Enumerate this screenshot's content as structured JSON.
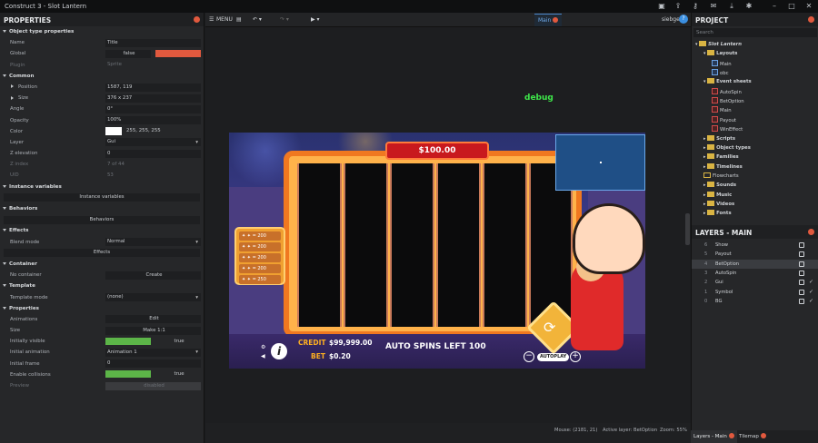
{
  "window": {
    "title": "Construct 3 - Slot Lantern"
  },
  "properties": {
    "title": "PROPERTIES",
    "rows": [
      {
        "type": "sec",
        "label": "Object type properties"
      },
      {
        "type": "row",
        "label": "Name",
        "value": "Title"
      },
      {
        "type": "global",
        "label": "Global",
        "value": "false"
      },
      {
        "type": "row",
        "label": "Plugin",
        "value": "Sprite",
        "dim": true
      },
      {
        "type": "sec",
        "label": "Common"
      },
      {
        "type": "exp",
        "label": "Position",
        "value": "1587, 119"
      },
      {
        "type": "exp",
        "label": "Size",
        "value": "376 x 237"
      },
      {
        "type": "row",
        "label": "Angle",
        "value": "0°"
      },
      {
        "type": "row",
        "label": "Opacity",
        "value": "100%"
      },
      {
        "type": "color",
        "label": "Color",
        "value": "255, 255, 255"
      },
      {
        "type": "select",
        "label": "Layer",
        "value": "Gui"
      },
      {
        "type": "row",
        "label": "Z elevation",
        "value": "0"
      },
      {
        "type": "row",
        "label": "Z index",
        "value": "7 of 44",
        "dim": true
      },
      {
        "type": "row",
        "label": "UID",
        "value": "53",
        "dim": true
      },
      {
        "type": "sec",
        "label": "Instance variables"
      },
      {
        "type": "wide",
        "value": "Instance variables"
      },
      {
        "type": "sec",
        "label": "Behaviors"
      },
      {
        "type": "wide",
        "value": "Behaviors"
      },
      {
        "type": "sec",
        "label": "Effects"
      },
      {
        "type": "select",
        "label": "Blend mode",
        "value": "Normal"
      },
      {
        "type": "wide",
        "value": "Effects"
      },
      {
        "type": "sec",
        "label": "Container"
      },
      {
        "type": "btn",
        "label": "No container",
        "value": "Create"
      },
      {
        "type": "sec",
        "label": "Template"
      },
      {
        "type": "select",
        "label": "Template mode",
        "value": "(none)"
      },
      {
        "type": "sec",
        "label": "Properties"
      },
      {
        "type": "btn",
        "label": "Animations",
        "value": "Edit"
      },
      {
        "type": "btn",
        "label": "Size",
        "value": "Make 1:1"
      },
      {
        "type": "bool",
        "label": "Initially visible",
        "value": "true"
      },
      {
        "type": "select",
        "label": "Initial animation",
        "value": "Animation 1"
      },
      {
        "type": "row",
        "label": "Initial frame",
        "value": "0"
      },
      {
        "type": "bool",
        "label": "Enable collisions",
        "value": "true"
      },
      {
        "type": "row",
        "label": "Preview",
        "value": "disabled",
        "dim": true
      }
    ]
  },
  "toolbar": {
    "menu": "MENU",
    "tab": "Main",
    "user": "siebgen"
  },
  "game": {
    "debug": "debug",
    "balance": "$100.00",
    "credit_label": "CREDIT",
    "credit": "$99,999.00",
    "bet_label": "BET",
    "bet": "$0.20",
    "auto_spins": "AUTO SPINS LEFT 100",
    "autoplay": "AUTOPLAY",
    "paytable": [
      "= 200",
      "= 200",
      "= 200",
      "= 200",
      "= 250"
    ]
  },
  "status": {
    "mouse": "Mouse: (2181, 21)",
    "layer": "Active layer: BetOption",
    "zoom": "Zoom: 55%"
  },
  "project": {
    "title": "PROJECT",
    "search": "Search",
    "tree": [
      {
        "d": 0,
        "k": "fo",
        "t": "Slot Lantern",
        "i": true
      },
      {
        "d": 1,
        "k": "fo",
        "t": "Layouts"
      },
      {
        "d": 2,
        "k": "ly",
        "t": "Main"
      },
      {
        "d": 2,
        "k": "ly",
        "t": "obc"
      },
      {
        "d": 1,
        "k": "fo",
        "t": "Event sheets"
      },
      {
        "d": 2,
        "k": "ev",
        "t": "AutoSpin"
      },
      {
        "d": 2,
        "k": "ev",
        "t": "BetOption"
      },
      {
        "d": 2,
        "k": "ev",
        "t": "Main"
      },
      {
        "d": 2,
        "k": "ev",
        "t": "Payout"
      },
      {
        "d": 2,
        "k": "ev",
        "t": "WinEffect"
      },
      {
        "d": 1,
        "k": "fc",
        "t": "Scripts"
      },
      {
        "d": 1,
        "k": "fc",
        "t": "Object types"
      },
      {
        "d": 1,
        "k": "fc",
        "t": "Families"
      },
      {
        "d": 1,
        "k": "fc",
        "t": "Timelines"
      },
      {
        "d": 1,
        "k": "fe",
        "t": "Flowcharts"
      },
      {
        "d": 1,
        "k": "fc",
        "t": "Sounds"
      },
      {
        "d": 1,
        "k": "fc",
        "t": "Music"
      },
      {
        "d": 1,
        "k": "fc",
        "t": "Videos"
      },
      {
        "d": 1,
        "k": "fc",
        "t": "Fonts"
      }
    ]
  },
  "layers": {
    "title": "LAYERS - MAIN",
    "items": [
      {
        "n": "6",
        "name": "Show",
        "check": false
      },
      {
        "n": "5",
        "name": "Payout",
        "check": false
      },
      {
        "n": "4",
        "name": "BetOption",
        "check": false,
        "sel": true
      },
      {
        "n": "3",
        "name": "AutoSpin",
        "check": false
      },
      {
        "n": "2",
        "name": "Gui",
        "check": true
      },
      {
        "n": "1",
        "name": "Symbol",
        "check": true
      },
      {
        "n": "0",
        "name": "BG",
        "check": true
      }
    ]
  },
  "bottom_tabs": {
    "layers": "Layers - Main",
    "tilemap": "Tilemap"
  }
}
